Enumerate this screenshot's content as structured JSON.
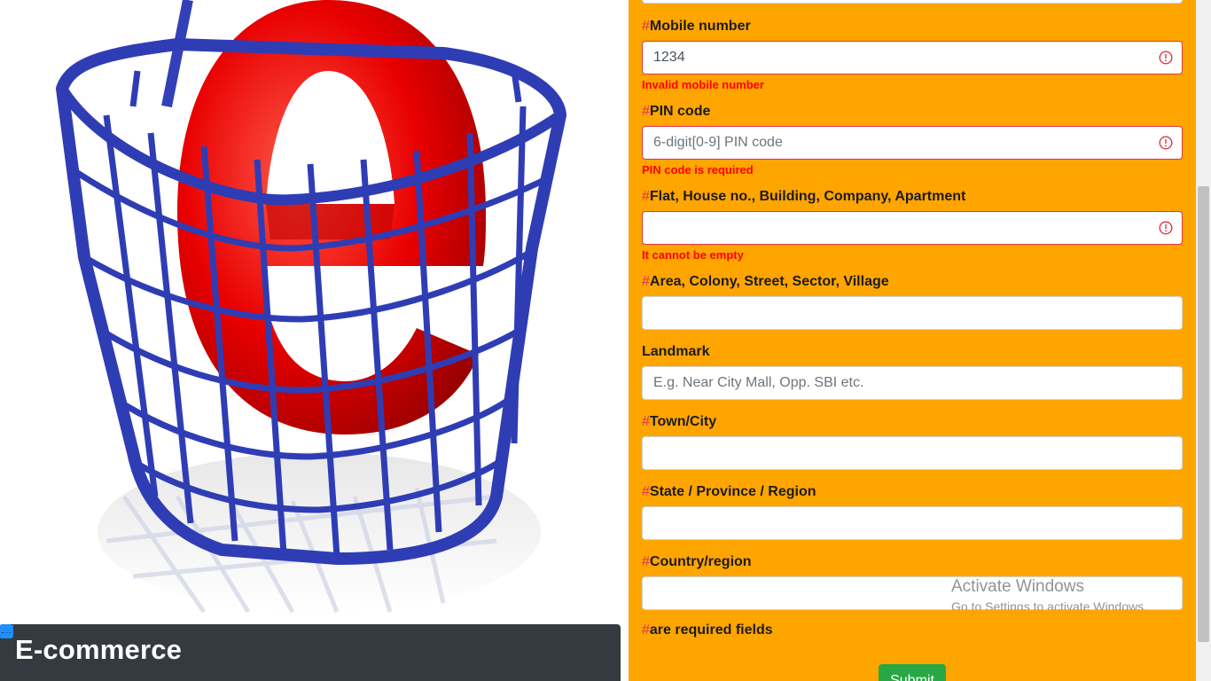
{
  "brand": {
    "name": "E-commerce"
  },
  "social": [
    "facebook-icon",
    "twitter-icon",
    "google-icon",
    "linkedin-icon",
    "youtube-icon",
    "instagram-icon"
  ],
  "colors": {
    "panel": "#ffa500",
    "error": "#dc3545",
    "footer": "#343a40",
    "social": "#1e90ff",
    "submit": "#28a745"
  },
  "form": {
    "mobile": {
      "hash": "#",
      "label": "Mobile number",
      "value": "1234",
      "error": "Invalid mobile number"
    },
    "pin": {
      "hash": "#",
      "label": "PIN code",
      "placeholder": "6-digit[0-9] PIN code",
      "error": "PIN code is required"
    },
    "flat": {
      "hash": "#",
      "label": "Flat, House no., Building, Company, Apartment",
      "error": "It cannot be empty"
    },
    "area": {
      "hash": "#",
      "label": "Area, Colony, Street, Sector, Village"
    },
    "landmark": {
      "label": "Landmark",
      "placeholder": "E.g. Near City Mall, Opp. SBI etc."
    },
    "town": {
      "hash": "#",
      "label": "Town/City"
    },
    "state": {
      "hash": "#",
      "label": "State / Province / Region"
    },
    "country": {
      "hash": "#",
      "label": "Country/region"
    },
    "required_note": {
      "hash": "#",
      "text": "are required fields"
    },
    "submit": "Submit"
  },
  "watermark": {
    "line1": "Activate Windows",
    "line2": "Go to Settings to activate Windows."
  }
}
